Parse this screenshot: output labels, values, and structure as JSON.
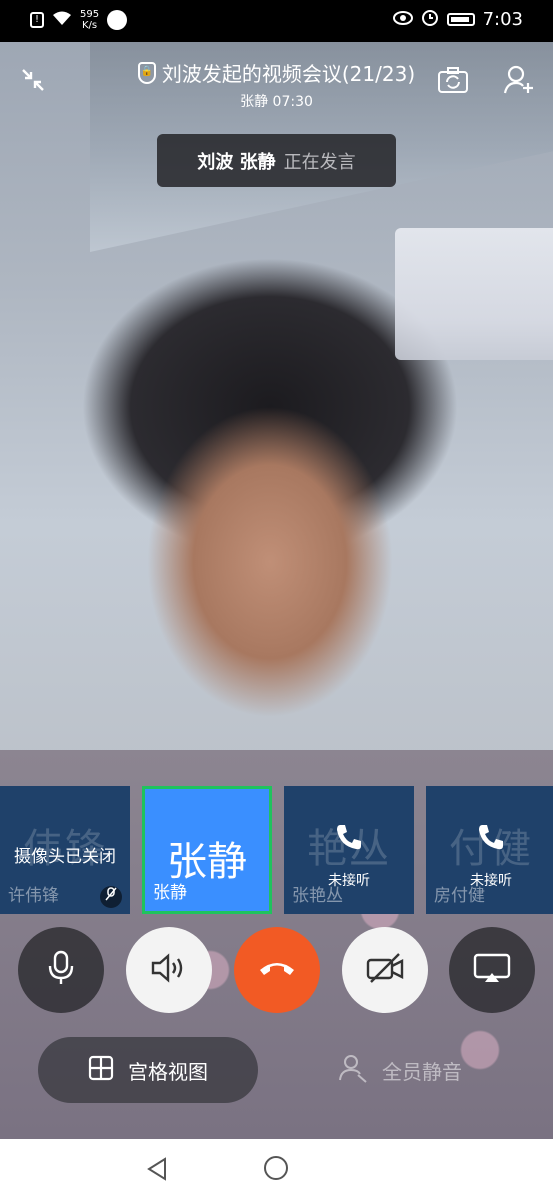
{
  "status_bar": {
    "speed_value": "595",
    "speed_unit": "K/s",
    "time": "7:03",
    "icons": [
      "sim-alert-icon",
      "wifi-icon",
      "app-notification-icon",
      "eye-icon",
      "alarm-icon",
      "battery-icon"
    ]
  },
  "header": {
    "title": "刘波发起的视频会议(21/23)",
    "subtitle": "张静 07:30",
    "icons": [
      "minimize-icon",
      "shield-icon",
      "camera-switch-icon",
      "add-participant-icon"
    ]
  },
  "speaking": {
    "names": "刘波 张静",
    "status": "正在发言"
  },
  "participants": [
    {
      "ghost": "伟锋",
      "center_text": "摄像头已关闭",
      "name": "许伟锋",
      "state": "camera-off",
      "muted": true
    },
    {
      "big": "张静",
      "name": "张静",
      "state": "active"
    },
    {
      "ghost": "艳丛",
      "status": "未接听",
      "name": "张艳丛",
      "state": "unanswered"
    },
    {
      "ghost": "付健",
      "status": "未接听",
      "name": "房付健",
      "state": "unanswered"
    }
  ],
  "controls": {
    "icons": [
      "microphone-icon",
      "speaker-icon",
      "hang-up-icon",
      "camera-off-icon",
      "screen-cast-icon"
    ]
  },
  "bottom": {
    "grid_view_label": "宫格视图",
    "mute_all_label": "全员静音"
  },
  "colors": {
    "active_tile": "#3a8fff",
    "active_border": "#1fc35d",
    "tile": "#1f416a",
    "hang_up": "#f25a24"
  }
}
